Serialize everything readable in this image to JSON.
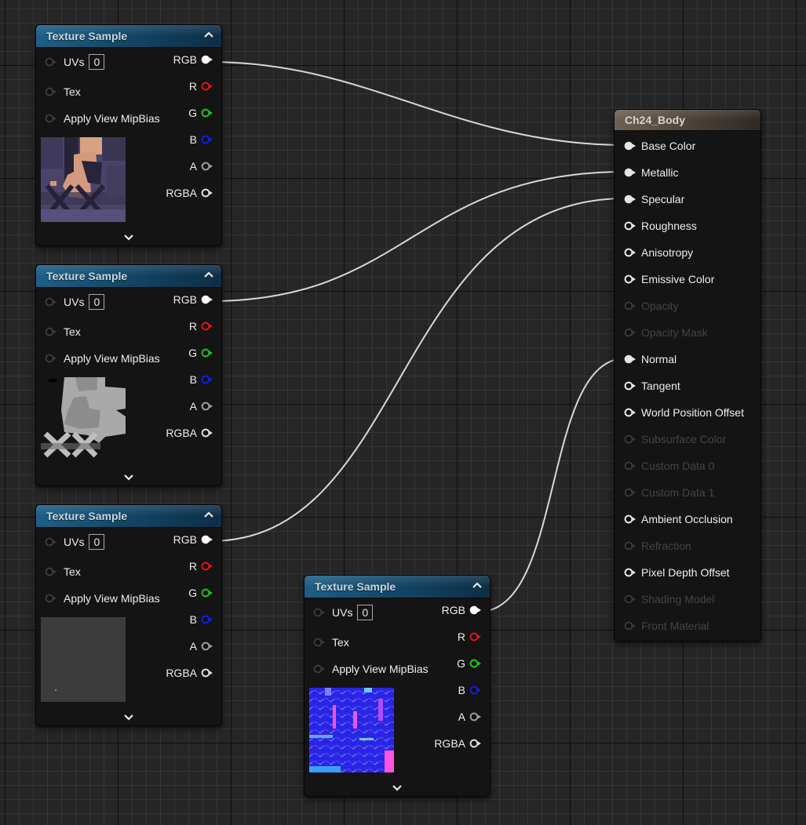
{
  "texture_nodes": [
    {
      "title": "Texture Sample",
      "inputs": [
        {
          "label": "UVs",
          "value": "0"
        },
        {
          "label": "Tex"
        },
        {
          "label": "Apply View MipBias"
        }
      ],
      "outputs": [
        {
          "label": "RGB",
          "color": "#ffffff",
          "connected": true
        },
        {
          "label": "R",
          "color": "#e01414",
          "connected": false
        },
        {
          "label": "G",
          "color": "#19c419",
          "connected": false
        },
        {
          "label": "B",
          "color": "#1a1ae0",
          "connected": false
        },
        {
          "label": "A",
          "color": "#9a9a9a",
          "connected": false
        },
        {
          "label": "RGBA",
          "color": "#dcdcdc",
          "connected": false
        }
      ],
      "preview": "base-color-texture"
    },
    {
      "title": "Texture Sample",
      "inputs": [
        {
          "label": "UVs",
          "value": "0"
        },
        {
          "label": "Tex"
        },
        {
          "label": "Apply View MipBias"
        }
      ],
      "outputs": [
        {
          "label": "RGB",
          "color": "#ffffff",
          "connected": true
        },
        {
          "label": "R",
          "color": "#e01414",
          "connected": false
        },
        {
          "label": "G",
          "color": "#19c419",
          "connected": false
        },
        {
          "label": "B",
          "color": "#1a1ae0",
          "connected": false
        },
        {
          "label": "A",
          "color": "#9a9a9a",
          "connected": false
        },
        {
          "label": "RGBA",
          "color": "#dcdcdc",
          "connected": false
        }
      ],
      "preview": "grayscale-mask-texture"
    },
    {
      "title": "Texture Sample",
      "inputs": [
        {
          "label": "UVs",
          "value": "0"
        },
        {
          "label": "Tex"
        },
        {
          "label": "Apply View MipBias"
        }
      ],
      "outputs": [
        {
          "label": "RGB",
          "color": "#ffffff",
          "connected": true
        },
        {
          "label": "R",
          "color": "#e01414",
          "connected": false
        },
        {
          "label": "G",
          "color": "#19c419",
          "connected": false
        },
        {
          "label": "B",
          "color": "#1a1ae0",
          "connected": false
        },
        {
          "label": "A",
          "color": "#9a9a9a",
          "connected": false
        },
        {
          "label": "RGBA",
          "color": "#dcdcdc",
          "connected": false
        }
      ],
      "preview": "flat-gray-texture"
    },
    {
      "title": "Texture Sample",
      "inputs": [
        {
          "label": "UVs",
          "value": "0"
        },
        {
          "label": "Tex"
        },
        {
          "label": "Apply View MipBias"
        }
      ],
      "outputs": [
        {
          "label": "RGB",
          "color": "#ffffff",
          "connected": true
        },
        {
          "label": "R",
          "color": "#e01414",
          "connected": false
        },
        {
          "label": "G",
          "color": "#19c419",
          "connected": false
        },
        {
          "label": "B",
          "color": "#1a1ae0",
          "connected": false
        },
        {
          "label": "A",
          "color": "#9a9a9a",
          "connected": false
        },
        {
          "label": "RGBA",
          "color": "#dcdcdc",
          "connected": false
        }
      ],
      "preview": "normal-map-texture"
    }
  ],
  "material_node": {
    "title": "Ch24_Body",
    "inputs": [
      {
        "label": "Base Color",
        "enabled": true,
        "connected": true
      },
      {
        "label": "Metallic",
        "enabled": true,
        "connected": true
      },
      {
        "label": "Specular",
        "enabled": true,
        "connected": true
      },
      {
        "label": "Roughness",
        "enabled": true,
        "connected": false
      },
      {
        "label": "Anisotropy",
        "enabled": true,
        "connected": false
      },
      {
        "label": "Emissive Color",
        "enabled": true,
        "connected": false
      },
      {
        "label": "Opacity",
        "enabled": false,
        "connected": false
      },
      {
        "label": "Opacity Mask",
        "enabled": false,
        "connected": false
      },
      {
        "label": "Normal",
        "enabled": true,
        "connected": true
      },
      {
        "label": "Tangent",
        "enabled": true,
        "connected": false
      },
      {
        "label": "World Position Offset",
        "enabled": true,
        "connected": false
      },
      {
        "label": "Subsurface Color",
        "enabled": false,
        "connected": false
      },
      {
        "label": "Custom Data 0",
        "enabled": false,
        "connected": false
      },
      {
        "label": "Custom Data 1",
        "enabled": false,
        "connected": false
      },
      {
        "label": "Ambient Occlusion",
        "enabled": true,
        "connected": false
      },
      {
        "label": "Refraction",
        "enabled": false,
        "connected": false
      },
      {
        "label": "Pixel Depth Offset",
        "enabled": true,
        "connected": false
      },
      {
        "label": "Shading Model",
        "enabled": false,
        "connected": false
      },
      {
        "label": "Front Material",
        "enabled": false,
        "connected": false
      }
    ]
  },
  "connections": [
    {
      "from_node": 0,
      "from_pin": "RGB",
      "to_pin": "Base Color"
    },
    {
      "from_node": 1,
      "from_pin": "RGB",
      "to_pin": "Metallic"
    },
    {
      "from_node": 2,
      "from_pin": "RGB",
      "to_pin": "Specular"
    },
    {
      "from_node": 3,
      "from_pin": "RGB",
      "to_pin": "Normal"
    }
  ],
  "icons": {
    "collapse": "chevron-up-icon",
    "expand": "chevron-down-icon",
    "pin": "pin-connector-icon"
  }
}
